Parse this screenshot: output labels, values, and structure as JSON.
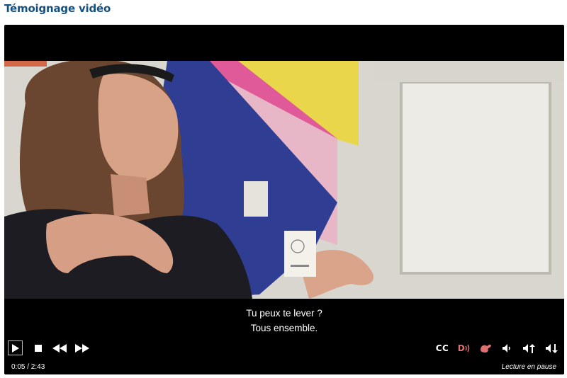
{
  "page": {
    "section_title": "Témoignage vidéo"
  },
  "player": {
    "subtitle_lines": [
      "Tu peux te lever ?",
      "Tous ensemble."
    ],
    "time_display": "0:05 / 2:43",
    "status_text": "Lecture en pause",
    "cc_label": "CC",
    "audio_description_label": "D",
    "accent_color": "#c9d14a",
    "active_feature_color": "#e07070",
    "title_color": "#17507f",
    "buttons": [
      {
        "name": "play-button",
        "icon": "play-icon"
      },
      {
        "name": "stop-button",
        "icon": "stop-icon"
      },
      {
        "name": "rewind-button",
        "icon": "rewind-icon"
      },
      {
        "name": "fast-forward-button",
        "icon": "fast-forward-icon"
      },
      {
        "name": "captions-button",
        "icon": "cc-icon"
      },
      {
        "name": "audio-description-button",
        "icon": "audio-description-icon"
      },
      {
        "name": "sign-language-button",
        "icon": "sign-language-icon"
      },
      {
        "name": "mute-button",
        "icon": "volume-icon"
      },
      {
        "name": "volume-up-button",
        "icon": "volume-up-icon"
      },
      {
        "name": "volume-down-button",
        "icon": "volume-down-icon"
      }
    ]
  }
}
